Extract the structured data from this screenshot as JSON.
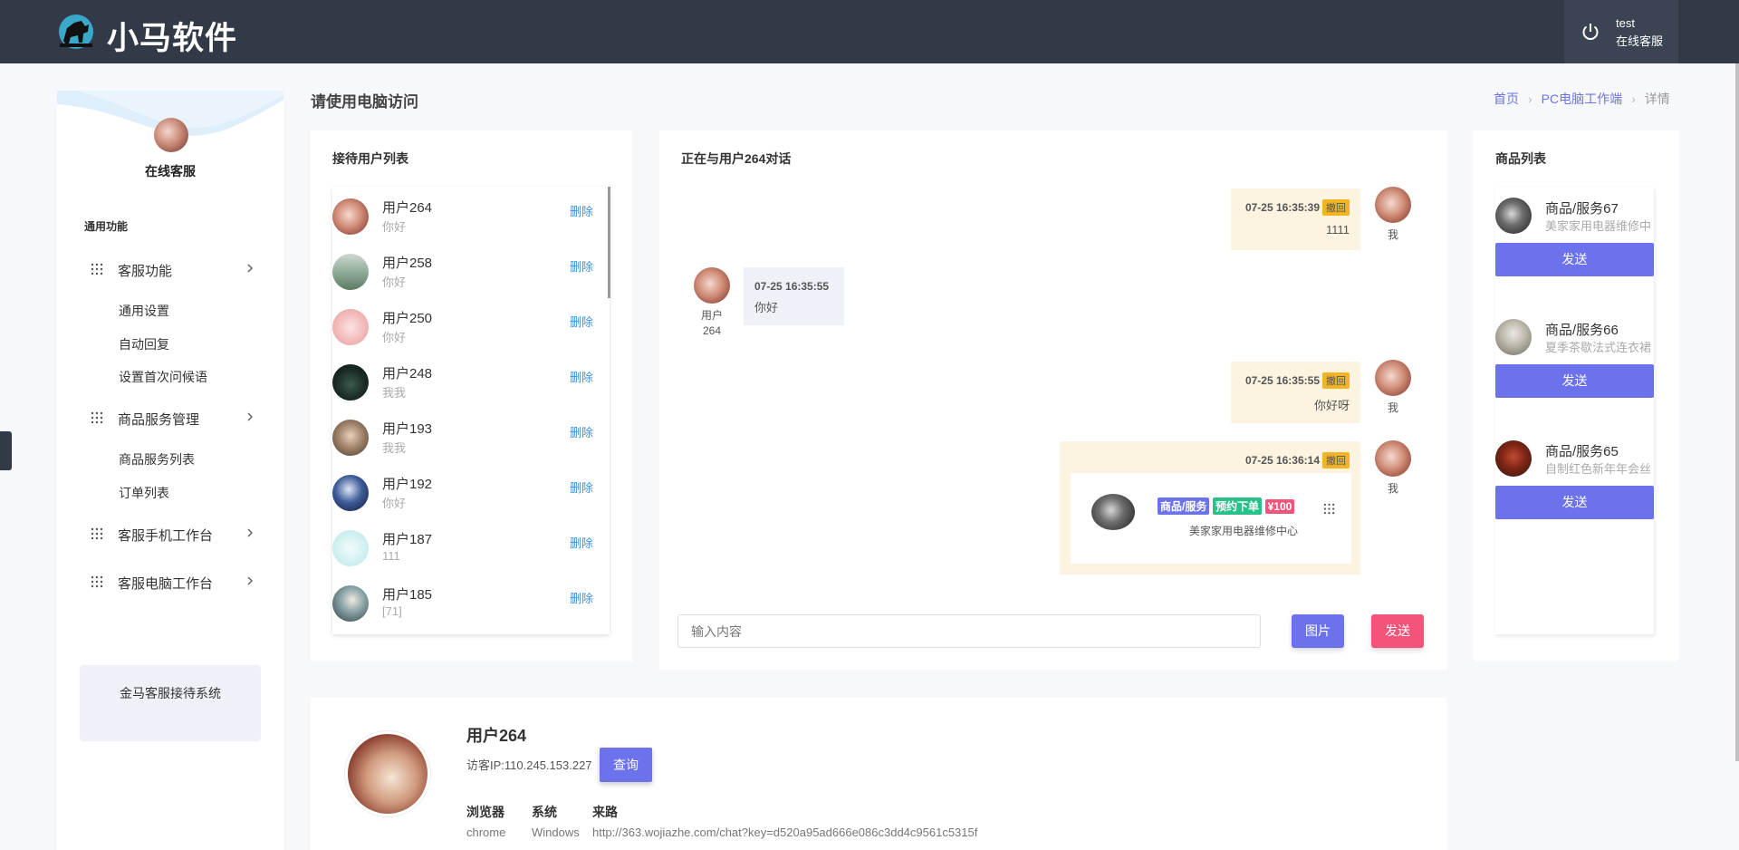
{
  "header": {
    "brand": "小马软件",
    "user_name": "test",
    "user_role": "在线客服",
    "logo_icon": "horse-logo-icon",
    "power_icon": "power-icon"
  },
  "sidebar": {
    "profile_name": "在线客服",
    "section_title": "通用功能",
    "menu": [
      {
        "label": "客服功能",
        "submenu": [
          "通用设置",
          "自动回复",
          "设置首次问候语"
        ]
      },
      {
        "label": "商品服务管理",
        "submenu": [
          "商品服务列表",
          "订单列表"
        ]
      },
      {
        "label": "客服手机工作台",
        "submenu": []
      },
      {
        "label": "客服电脑工作台",
        "submenu": []
      }
    ],
    "footer": "金马客服接待系统"
  },
  "page": {
    "title": "请使用电脑访问",
    "breadcrumb": [
      "首页",
      "PC电脑工作端",
      "详情"
    ]
  },
  "user_list": {
    "title": "接待用户列表",
    "delete_label": "删除",
    "users": [
      {
        "name": "用户264",
        "msg": "你好"
      },
      {
        "name": "用户258",
        "msg": "你好"
      },
      {
        "name": "用户250",
        "msg": "你好"
      },
      {
        "name": "用户248",
        "msg": "我我"
      },
      {
        "name": "用户193",
        "msg": "我我"
      },
      {
        "name": "用户192",
        "msg": "你好"
      },
      {
        "name": "用户187",
        "msg": "111"
      },
      {
        "name": "用户185",
        "msg": "[71]"
      }
    ]
  },
  "chat": {
    "title": "正在与用户264对话",
    "recall_label": "撤回",
    "me_label": "我",
    "user_label_line1": "用户",
    "user_label_line2": "264",
    "messages": [
      {
        "time": "07-25 16:35:39",
        "text": "1111"
      },
      {
        "time": "07-25 16:35:55",
        "text": "你好"
      },
      {
        "time": "07-25 16:35:55",
        "text": "你好呀"
      },
      {
        "time": "07-25 16:36:14"
      }
    ],
    "product_card": {
      "tag1": "商品/服务",
      "tag2": "预约下单",
      "tag3": "¥100",
      "desc": "美家家用电器维修中心"
    },
    "input_placeholder": "输入内容",
    "image_button": "图片",
    "send_button": "发送"
  },
  "products": {
    "title": "商品列表",
    "send_label": "发送",
    "items": [
      {
        "name": "商品/服务67",
        "desc": "美家家用电器维修中"
      },
      {
        "name": "商品/服务66",
        "desc": "夏季茶歇法式连衣裙"
      },
      {
        "name": "商品/服务65",
        "desc": "自制红色新年年会丝"
      }
    ]
  },
  "visitor": {
    "name": "用户264",
    "ip": "访客IP:110.245.153.227",
    "query_button": "查询",
    "browser_label": "浏览器",
    "browser": "chrome",
    "os_label": "系统",
    "os": "Windows",
    "source_label": "来路",
    "source": "http://363.wojiazhe.com/chat?key=d520a95ad666e086c3dd4c9561c5315f"
  },
  "colors": {
    "header_bg": "#323a47",
    "accent": "#6c72ec",
    "send_pink": "#f5547a",
    "recall_yellow": "#f2b420",
    "tag_green": "#27c28a",
    "tag_red": "#f5547a"
  }
}
